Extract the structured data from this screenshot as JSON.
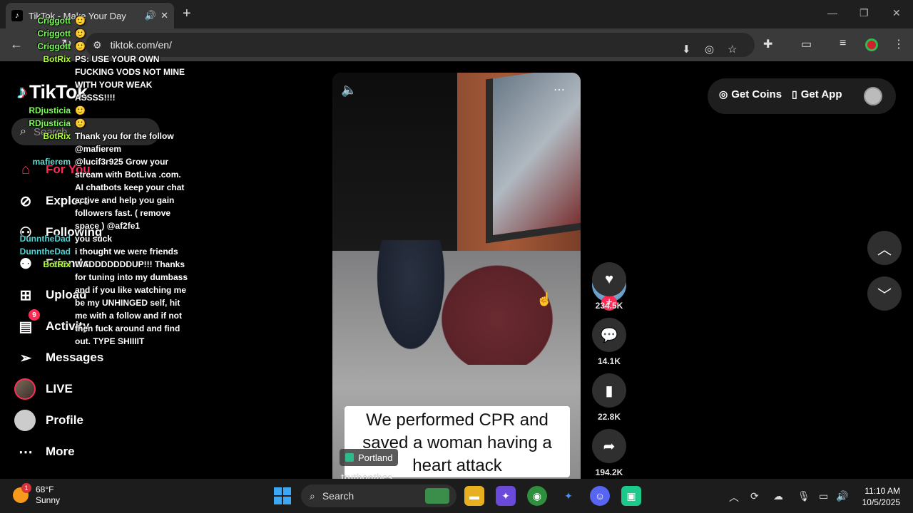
{
  "browser": {
    "tab_title": "TikTok - Make Your Day",
    "url": "tiktok.com/en/"
  },
  "sidebar": {
    "logo_text": "TikTok",
    "search_placeholder": "Search",
    "nav": [
      {
        "label": "For You",
        "icon": "home-icon"
      },
      {
        "label": "Explore",
        "icon": "compass-icon"
      },
      {
        "label": "Following",
        "icon": "person-icon"
      },
      {
        "label": "Friends",
        "icon": "friends-icon"
      },
      {
        "label": "Upload",
        "icon": "plus-square-icon"
      },
      {
        "label": "Activity",
        "icon": "message-icon",
        "badge": "9"
      },
      {
        "label": "Messages",
        "icon": "send-icon"
      },
      {
        "label": "LIVE",
        "icon": "live-avatar"
      },
      {
        "label": "Profile",
        "icon": "profile-avatar"
      },
      {
        "label": "More",
        "icon": "more-icon"
      }
    ]
  },
  "chat": [
    {
      "user": "Criggott",
      "text": "",
      "color": "#7cfc5a"
    },
    {
      "user": "Criggott",
      "text": "",
      "color": "#7cfc5a"
    },
    {
      "user": "Criggott",
      "text": "",
      "color": "#7cfc5a"
    },
    {
      "user": "BotRix",
      "text": "PS: USE YOUR OWN FUCKING VODS NOT MINE WITH YOUR WEAK ASSSS!!!!",
      "color": "#b4ff3c"
    },
    {
      "user": "RDjusticia",
      "text": "",
      "color": "#7cfc5a"
    },
    {
      "user": "RDjusticia",
      "text": "",
      "color": "#7cfc5a"
    },
    {
      "user": "BotRix",
      "text": "Thank you for the follow @mafierem",
      "color": "#b4ff3c"
    },
    {
      "user": "mafierem",
      "text": "@lucif3r925 Grow your stream with BotLiva .com. AI chatbots keep your chat active and help you gain followers fast. ( remove space ) @af2fe1",
      "color": "#5ee0d0"
    },
    {
      "user": "DunntheDad",
      "text": "you suck",
      "color": "#48d8d8"
    },
    {
      "user": "DunntheDad",
      "text": "i thought we were friends",
      "color": "#48d8d8"
    },
    {
      "user": "BotRix",
      "text": "WADDDDDDDUP!!! Thanks for tuning into my dumbass and if you like watching me be my UNHINGED self, hit me with a follow and if not then fuck around and find out. TYPE SHIIIIT",
      "color": "#b4ff3c"
    }
  ],
  "video": {
    "caption": "We performed CPR and saved a woman having a heart attack",
    "location": "Portland",
    "author": "truthonthes..."
  },
  "actions": {
    "likes": "234.5K",
    "comments": "14.1K",
    "saves": "22.8K",
    "shares": "194.2K",
    "creator_avatar_text": "blues"
  },
  "topright": {
    "get_coins": "Get Coins",
    "get_app": "Get App"
  },
  "taskbar": {
    "weather_temp": "68°F",
    "weather_desc": "Sunny",
    "weather_badge": "1",
    "search_label": "Search",
    "time": "11:10 AM",
    "date": "10/5/2025"
  }
}
